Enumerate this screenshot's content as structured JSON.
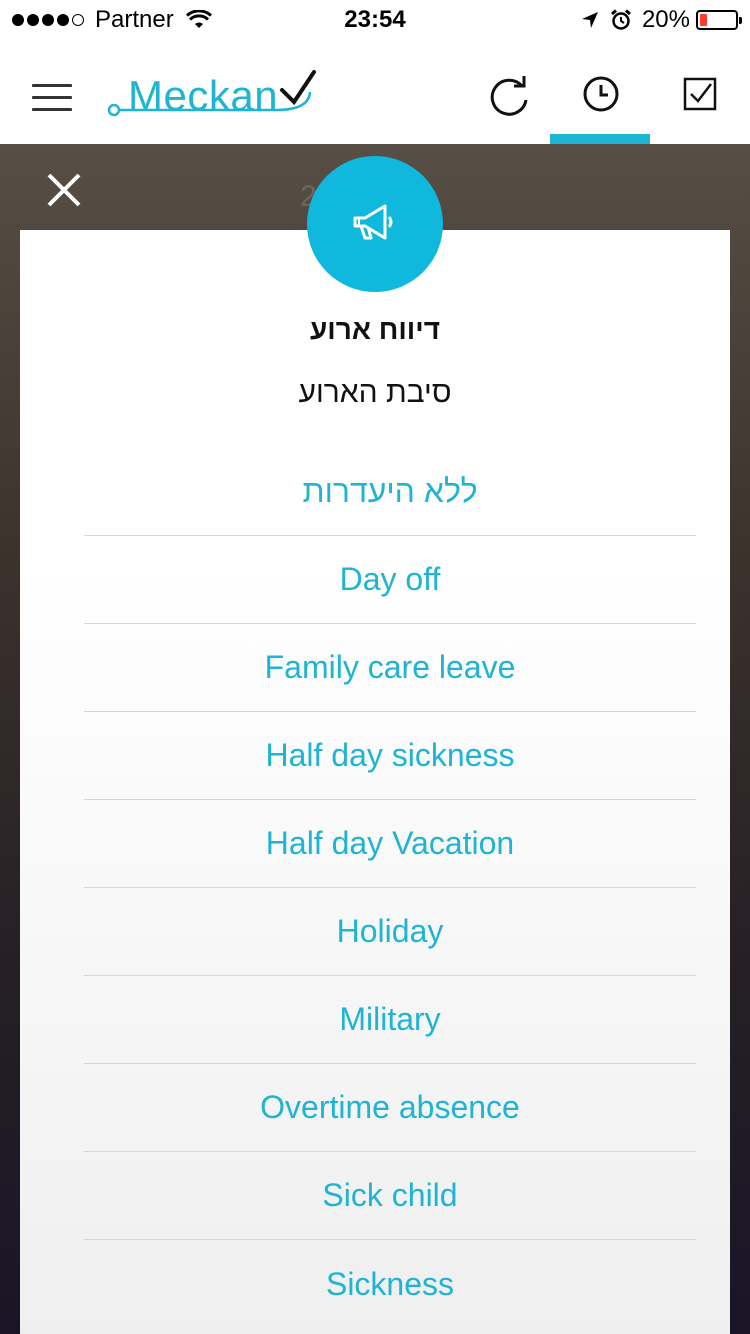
{
  "status": {
    "carrier": "Partner",
    "time": "23:54",
    "battery_percent": "20%",
    "battery_level": 0.2,
    "signal_bars": 4,
    "icons": [
      "wifi-icon",
      "location-arrow-icon",
      "alarm-icon",
      "battery-icon"
    ]
  },
  "header": {
    "logo_text": "Meckano",
    "logo_display": "Meckan",
    "buttons": [
      "refresh-icon",
      "clock-icon",
      "checkbox-icon"
    ],
    "active_tab": "clock"
  },
  "overlay": {
    "background_text": "2      7"
  },
  "dialog": {
    "icon": "megaphone-icon",
    "title": "דיווח ארוע",
    "subtitle": "סיבת הארוע",
    "options": [
      {
        "label": "ללא היעדרות"
      },
      {
        "label": "Day off"
      },
      {
        "label": "Family care leave"
      },
      {
        "label": "Half day sickness"
      },
      {
        "label": "Half day Vacation"
      },
      {
        "label": "Holiday"
      },
      {
        "label": "Military"
      },
      {
        "label": "Overtime absence"
      },
      {
        "label": "Sick child"
      },
      {
        "label": "Sickness"
      }
    ]
  },
  "colors": {
    "accent": "#1eb4d2",
    "badge": "#10b8de",
    "battery_low": "#ff3b30"
  }
}
